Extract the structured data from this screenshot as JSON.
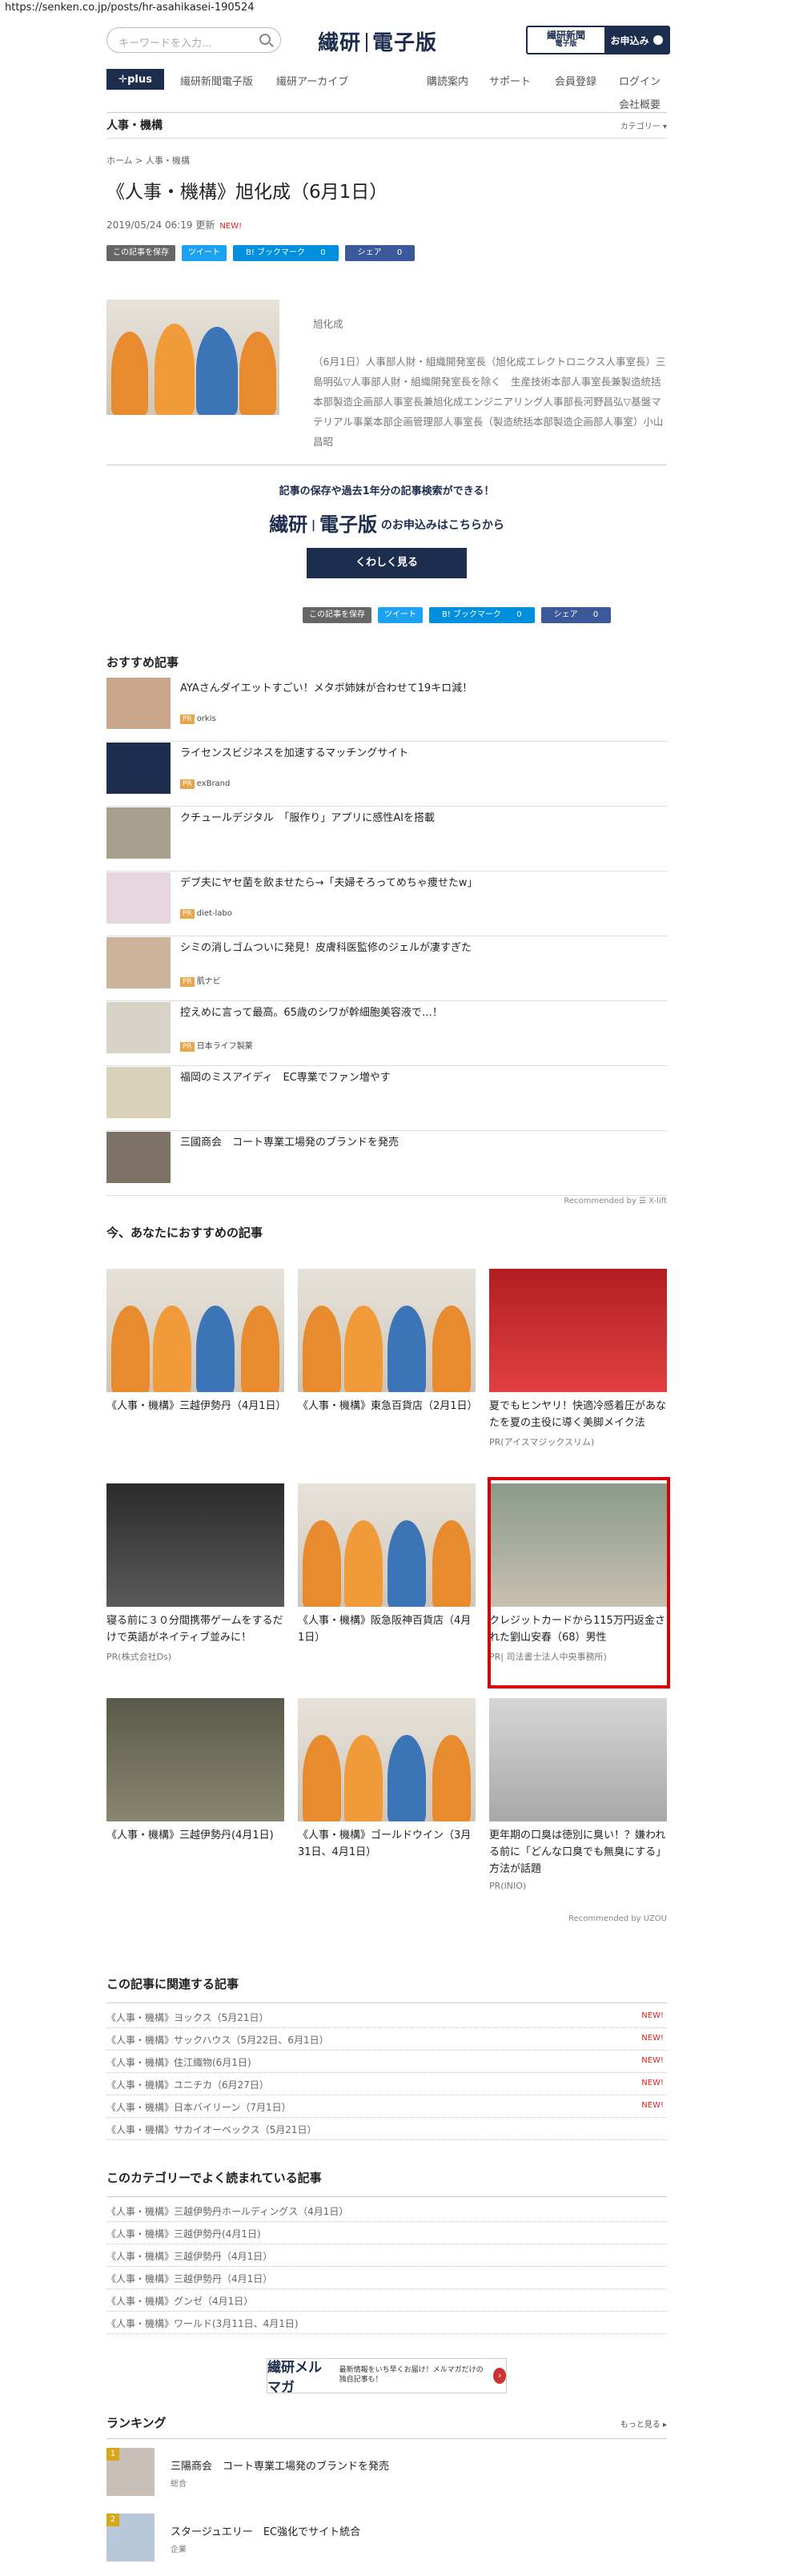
{
  "url": "https://senken.co.jp/posts/hr-asahikasei-190524",
  "header": {
    "search_placeholder": "キーワードを入力...",
    "logo_left": "繊研",
    "logo_right": "電子版",
    "sub_title": "繊研新聞",
    "sub_subtitle": "電子版",
    "sub_button": "お申込み"
  },
  "nav": {
    "plus": "✛plus",
    "items": [
      "繊研新聞電子版",
      "繊研アーカイブ"
    ],
    "right": [
      "購読案内",
      "サポート",
      "会員登録",
      "ログイン"
    ],
    "company": "会社概要"
  },
  "category": {
    "title": "人事・機構",
    "dropdown": "カテゴリー ▾"
  },
  "article": {
    "breadcrumb": "ホーム > 人事・機構",
    "title": "《人事・機構》旭化成（6月1日）",
    "date": "2019/05/24 06:19 更新",
    "new": "NEW!",
    "company": "旭化成",
    "body": "（6月1日）人事部人財・組織開発室長（旭化成エレクトロニクス人事室長）三島明弘▽人事部人財・組織開発室長を除く　生産技術本部人事室長兼製造統括本部製造企画部人事室長兼旭化成エンジニアリング人事部長河野昌弘▽基盤マテリアル事業本部企画管理部人事室長（製造統括本部製造企画部人事室）小山昌昭"
  },
  "share": {
    "save": "この記事を保存",
    "tweet": "ツイート",
    "hatena": "B! ブックマーク",
    "hatena_count": "0",
    "facebook": "シェア",
    "facebook_count": "0"
  },
  "promo": {
    "line1": "記事の保存や過去1年分の記事検索ができる！",
    "logo_left": "繊研",
    "logo_right": "電子版",
    "line2": "のお申込みはこちらから",
    "button": "くわしく見る"
  },
  "recommended": {
    "title": "おすすめ記事",
    "items": [
      {
        "text": "AYAさんダイエットすごい！メタボ姉妹が合わせて19キロ減！",
        "pr": "orkis"
      },
      {
        "text": "ライセンスビジネスを加速するマッチングサイト",
        "pr": "exBrand"
      },
      {
        "text": "クチュールデジタル　「服作り」アプリに感性AIを搭載",
        "pr": ""
      },
      {
        "text": "デブ夫にヤセ菌を飲ませたら→「夫婦そろってめちゃ痩せたw」",
        "pr": "diet-labo"
      },
      {
        "text": "シミの消しゴムついに発見！皮膚科医監修のジェルが凄すぎた",
        "pr": "肌ナビ"
      },
      {
        "text": "控えめに言って最高。65歳のシワが幹細胞美容液で…！",
        "pr": "日本ライフ製薬"
      },
      {
        "text": "福岡のミスアイディ　EC専業でファン増やす",
        "pr": ""
      },
      {
        "text": "三國商会　コート専業工場発のブランドを発売",
        "pr": ""
      }
    ],
    "by": "Recommended by ☰ X-lift"
  },
  "foryou": {
    "title": "今、あなたにおすすめの記事",
    "cards": [
      {
        "title": "《人事・機構》三越伊勢丹（4月1日）",
        "source": ""
      },
      {
        "title": "《人事・機構》東急百貨店（2月1日）",
        "source": ""
      },
      {
        "title": "夏でもヒンヤリ！快適冷感着圧があなたを夏の主役に導く美脚メイク法",
        "source": "PR(アイスマジックスリム)"
      },
      {
        "title": "寝る前に３０分間携帯ゲームをするだけで英語がネイティブ並みに！",
        "source": "PR(株式会社Ds)"
      },
      {
        "title": "《人事・機構》阪急阪神百貨店（4月1日）",
        "source": ""
      },
      {
        "title": "クレジットカードから115万円返金された劉山安春（68）男性",
        "source": "PR| 司法書士法人中央事務所)"
      },
      {
        "title": "《人事・機構》三越伊勢丹(4月1日)",
        "source": ""
      },
      {
        "title": "《人事・機構》ゴールドウイン（3月31日、4月1日）",
        "source": ""
      },
      {
        "title": "更年期の口臭は徳別に臭い！？嫌われる前に「どんな口臭でも無臭にする」方法が話題",
        "source": "PR(INIO)"
      }
    ],
    "by": "Recommended by UZOU"
  },
  "related": {
    "title": "この記事に関連する記事",
    "items": [
      {
        "text": "《人事・機構》ヨックス（5月21日）",
        "new": "NEW!"
      },
      {
        "text": "《人事・機構》サックハウス（5月22日、6月1日）",
        "new": "NEW!"
      },
      {
        "text": "《人事・機構》住江織物(6月1日)",
        "new": "NEW!"
      },
      {
        "text": "《人事・機構》ユニチカ（6月27日）",
        "new": "NEW!"
      },
      {
        "text": "《人事・機構》日本バイリーン（7月1日）",
        "new": "NEW!"
      },
      {
        "text": "《人事・機構》サカイオーベックス（5月21日）",
        "new": ""
      }
    ]
  },
  "popular": {
    "title": "このカテゴリーでよく読まれている記事",
    "items": [
      "《人事・機構》三越伊勢丹ホールディングス（4月1日）",
      "《人事・機構》三越伊勢丹(4月1日)",
      "《人事・機構》三越伊勢丹（4月1日）",
      "《人事・機構》三越伊勢丹（4月1日）",
      "《人事・機構》グンゼ（4月1日）",
      "《人事・機構》ワールド(3月11日、4月1日)"
    ]
  },
  "mailmag": {
    "title": "繊研メルマガ",
    "text": "最新情報をいち早くお届け！メルマガだけの独自記事も！",
    "arrow": "›"
  },
  "ranking": {
    "title": "ランキング",
    "more": "もっと見る ▸",
    "items": [
      {
        "no": "1",
        "text": "三陽商会　コート専業工場発のブランドを発売",
        "sub": "総合"
      },
      {
        "no": "2",
        "text": "スタージュエリー　EC強化でサイト統合",
        "sub": "企業"
      }
    ]
  }
}
